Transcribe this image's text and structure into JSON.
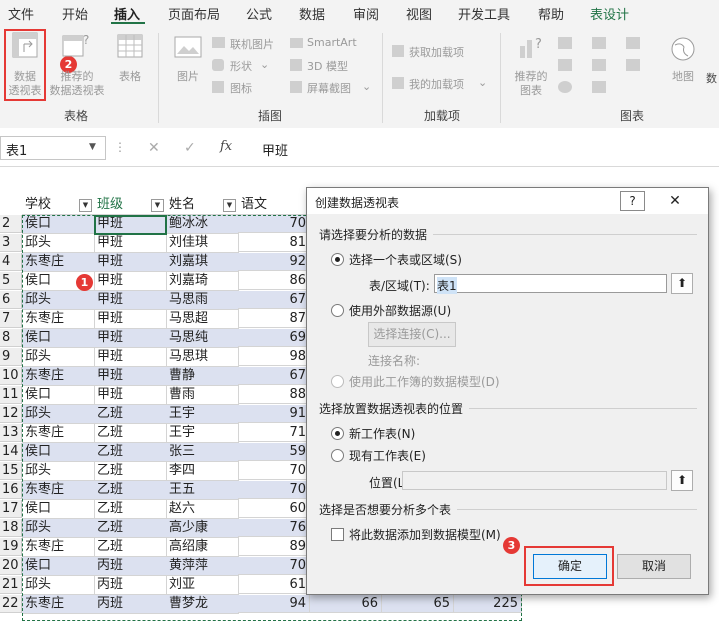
{
  "tabs": [
    "文件",
    "开始",
    "插入",
    "页面布局",
    "公式",
    "数据",
    "审阅",
    "视图",
    "开发工具",
    "帮助",
    "表设计"
  ],
  "ribbon": {
    "pivot_table": [
      "数据",
      "透视表"
    ],
    "recommended_pivot": [
      "推荐的",
      "数据透视表"
    ],
    "table": "表格",
    "group_tables": "表格",
    "picture": "图片",
    "online_picture": "联机图片",
    "shapes": "形状",
    "icons": "图标",
    "smartart": "SmartArt",
    "model3d": "3D 模型",
    "screenshot": "屏幕截图",
    "group_illustrations": "插图",
    "get_addins": "获取加载项",
    "my_addins": "我的加载项",
    "group_addins": "加载项",
    "recommended_charts": [
      "推荐的",
      "图表"
    ],
    "map": "地图",
    "data_cut": "数",
    "group_charts": "图表"
  },
  "formula_bar": {
    "name_box": "表1",
    "fx": "fx",
    "value": "甲班"
  },
  "table": {
    "headers": [
      "学校",
      "班级",
      "姓名",
      "语文"
    ],
    "rows": [
      {
        "n": "2",
        "school": "侯口",
        "class": "甲班",
        "name": "鲍冰冰",
        "score": "70"
      },
      {
        "n": "3",
        "school": "邱头",
        "class": "甲班",
        "name": "刘佳琪",
        "score": "81"
      },
      {
        "n": "4",
        "school": "东枣庄",
        "class": "甲班",
        "name": "刘嘉琪",
        "score": "92"
      },
      {
        "n": "5",
        "school": "侯口",
        "class": "甲班",
        "name": "刘嘉琦",
        "score": "86"
      },
      {
        "n": "6",
        "school": "邱头",
        "class": "甲班",
        "name": "马思雨",
        "score": "67"
      },
      {
        "n": "7",
        "school": "东枣庄",
        "class": "甲班",
        "name": "马思超",
        "score": "87"
      },
      {
        "n": "8",
        "school": "侯口",
        "class": "甲班",
        "name": "马思纯",
        "score": "69"
      },
      {
        "n": "9",
        "school": "邱头",
        "class": "甲班",
        "name": "马思琪",
        "score": "98"
      },
      {
        "n": "10",
        "school": "东枣庄",
        "class": "甲班",
        "name": "曹静",
        "score": "67"
      },
      {
        "n": "11",
        "school": "侯口",
        "class": "甲班",
        "name": "曹雨",
        "score": "88"
      },
      {
        "n": "12",
        "school": "邱头",
        "class": "乙班",
        "name": "王宇",
        "score": "91"
      },
      {
        "n": "13",
        "school": "东枣庄",
        "class": "乙班",
        "name": "王宇",
        "score": "71"
      },
      {
        "n": "14",
        "school": "侯口",
        "class": "乙班",
        "name": "张三",
        "score": "59"
      },
      {
        "n": "15",
        "school": "邱头",
        "class": "乙班",
        "name": "李四",
        "score": "70"
      },
      {
        "n": "16",
        "school": "东枣庄",
        "class": "乙班",
        "name": "王五",
        "score": "70"
      },
      {
        "n": "17",
        "school": "侯口",
        "class": "乙班",
        "name": "赵六",
        "score": "60"
      },
      {
        "n": "18",
        "school": "邱头",
        "class": "乙班",
        "name": "高少康",
        "score": "76"
      },
      {
        "n": "19",
        "school": "东枣庄",
        "class": "乙班",
        "name": "高绍康",
        "score": "89"
      },
      {
        "n": "20",
        "school": "侯口",
        "class": "丙班",
        "name": "黄萍萍",
        "score": "70"
      },
      {
        "n": "21",
        "school": "邱头",
        "class": "丙班",
        "name": "刘亚",
        "score": "61"
      },
      {
        "n": "22",
        "school": "东枣庄",
        "class": "丙班",
        "name": "曹梦龙",
        "score": "94",
        "e": "66",
        "f": "65",
        "g": "225"
      }
    ]
  },
  "dialog": {
    "title": "创建数据透视表",
    "help": "?",
    "close": "✕",
    "section1": "请选择要分析的数据",
    "opt_select_table": "选择一个表或区域(S)",
    "table_range_label": "表/区域(T):",
    "table_range_value": "表1",
    "opt_external": "使用外部数据源(U)",
    "choose_connection": "选择连接(C)...",
    "connection_name": "连接名称:",
    "opt_data_model": "使用此工作簿的数据模型(D)",
    "section2": "选择放置数据透视表的位置",
    "opt_new_sheet": "新工作表(N)",
    "opt_existing_sheet": "现有工作表(E)",
    "location_label": "位置(L):",
    "section3": "选择是否想要分析多个表",
    "add_to_model": "将此数据添加到数据模型(M)",
    "ok": "确定",
    "cancel": "取消"
  },
  "badges": [
    "1",
    "2",
    "3"
  ],
  "colors": {
    "band": "#dce1f0",
    "accent": "#217346",
    "marker": "#e53935"
  }
}
